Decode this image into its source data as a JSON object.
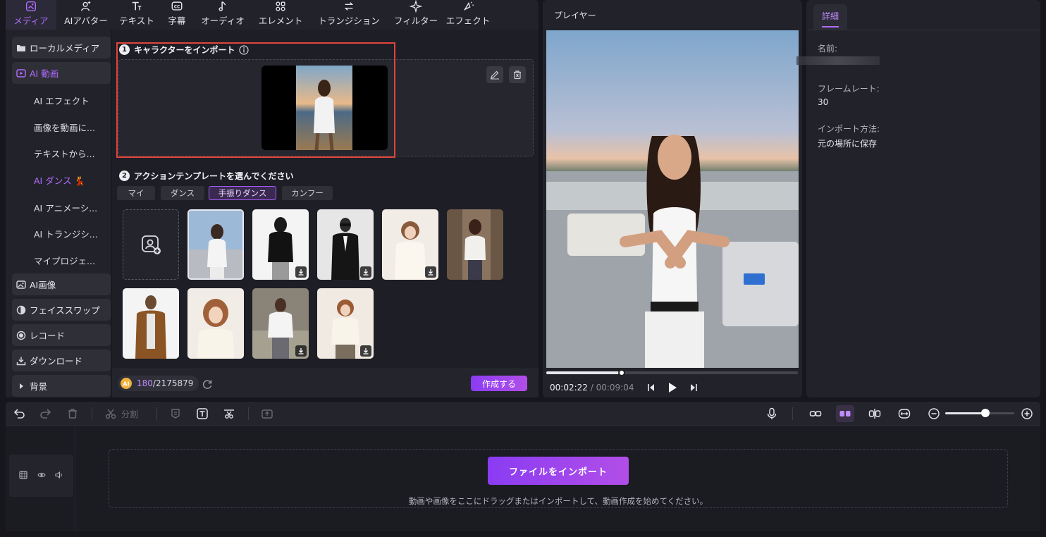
{
  "top_tabs": [
    {
      "label": "メディア",
      "icon": "media-icon",
      "active": true
    },
    {
      "label": "AIアバター",
      "icon": "ai-avatar-icon"
    },
    {
      "label": "テキスト",
      "icon": "text-icon"
    },
    {
      "label": "字幕",
      "icon": "subtitle-icon"
    },
    {
      "label": "オーディオ",
      "icon": "music-note-icon"
    },
    {
      "label": "エレメント",
      "icon": "element-icon"
    },
    {
      "label": "トランジション",
      "icon": "transition-icon"
    },
    {
      "label": "フィルター",
      "icon": "filter-sparkle-icon"
    },
    {
      "label": "エフェクト",
      "icon": "effect-icon"
    }
  ],
  "left_nav": {
    "local_media": "ローカルメディア",
    "ai_video": "AI 動画",
    "sub": [
      "AI エフェクト",
      "画像を動画に...",
      "テキストから...",
      "AI ダンス 💃",
      "AI アニメーシ...",
      "AI トランジシ...",
      "マイプロジェ..."
    ],
    "ai_image": "AI画像",
    "face_swap": "フェイススワップ",
    "record": "レコード",
    "download": "ダウンロード",
    "background": "背景"
  },
  "mid": {
    "step1_num": "1",
    "step1_title": "キャラクターをインポート",
    "step2_num": "2",
    "step2_title": "アクションテンプレートを選んでください",
    "chips": [
      "マイ",
      "ダンス",
      "手振りダンス",
      "カンフー"
    ],
    "credits_used": "180",
    "credits_total": "/2175879",
    "create_button": "作成する"
  },
  "player": {
    "title": "プレイヤー",
    "time_current": "00:02:22",
    "time_sep": " / ",
    "time_total": "00:09:04",
    "progress": 0.3
  },
  "details": {
    "tab": "詳細",
    "name_label": "名前:",
    "fps_label": "フレームレート:",
    "fps_value": "30",
    "import_label": "インポート方法:",
    "import_value": "元の場所に保存"
  },
  "timeline": {
    "split_label": "分割",
    "import_button": "ファイルをインポート",
    "hint": "動画や画像をここにドラッグまたはインポートして、動画作成を始めてください。",
    "zoom": 0.58
  },
  "colors": {
    "accent": "#b26cff",
    "highlight_box": "#e0453a"
  }
}
